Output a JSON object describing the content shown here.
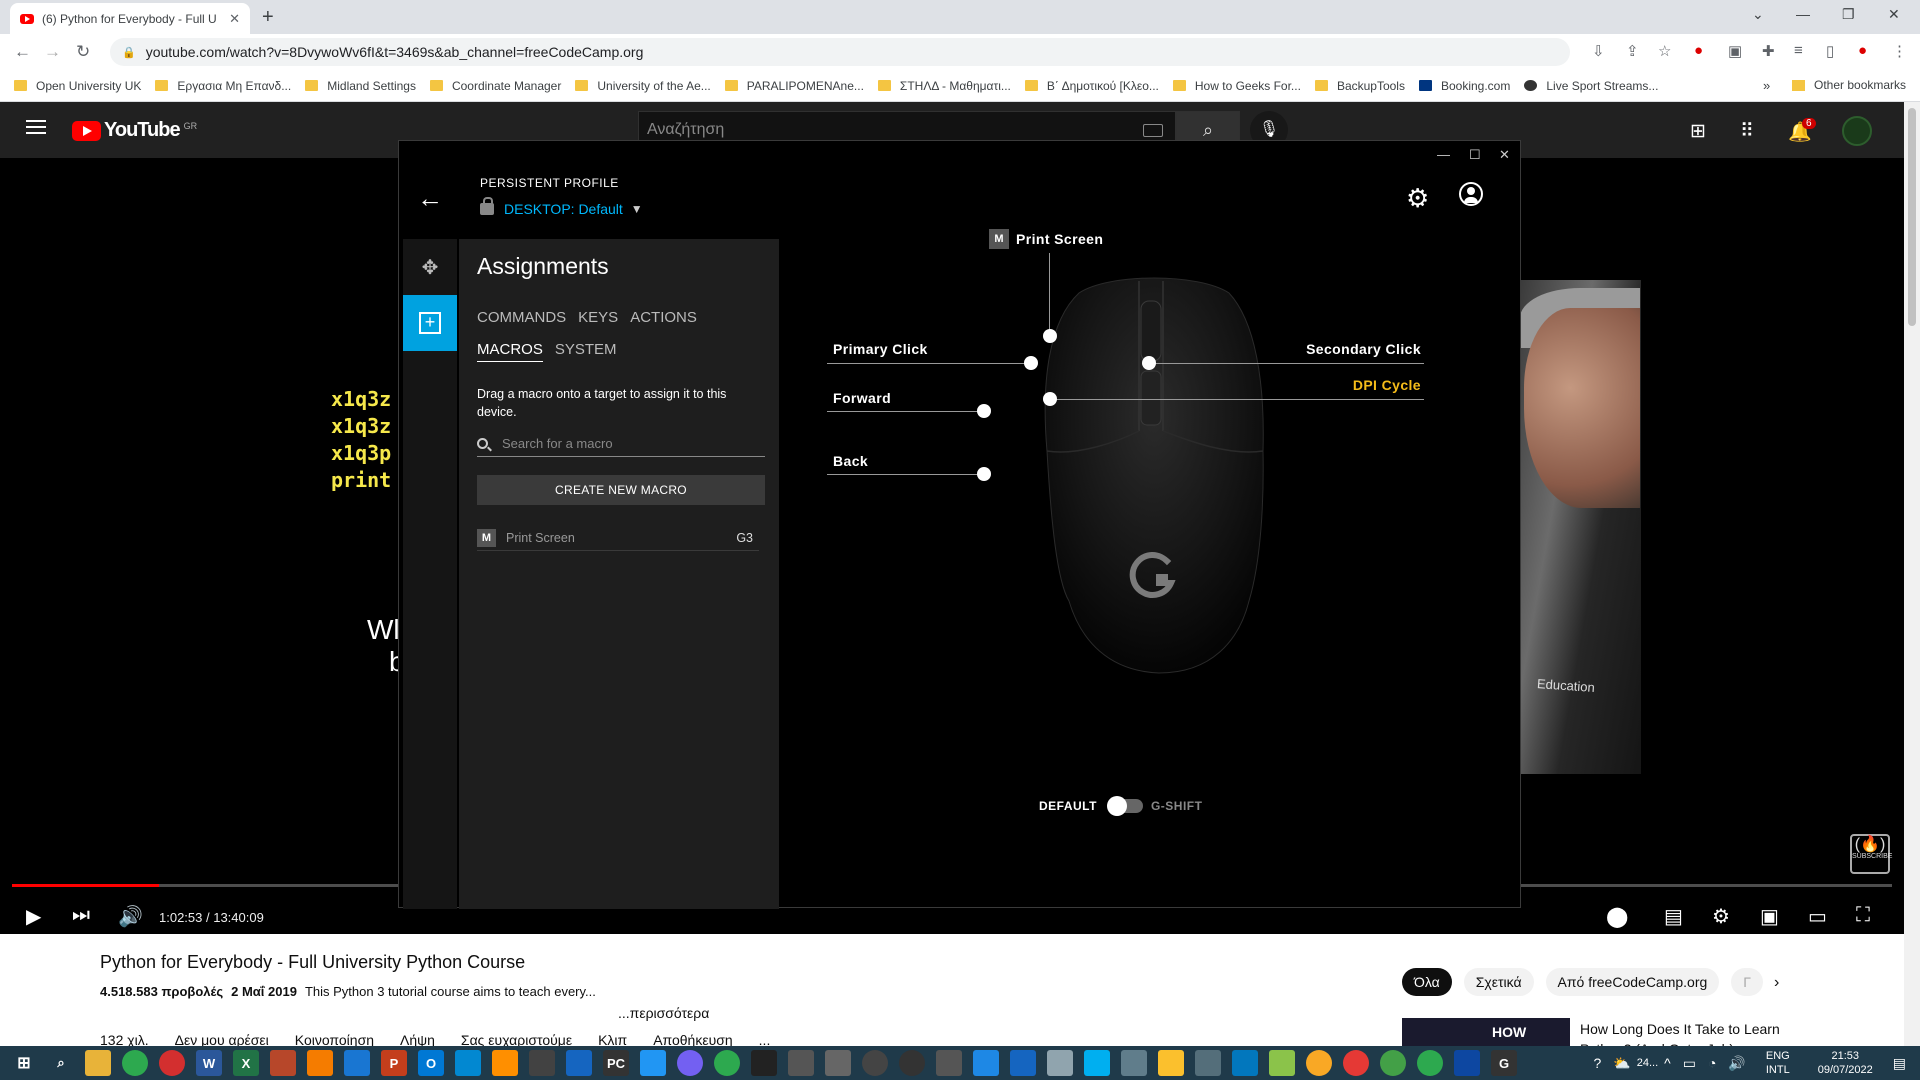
{
  "browser": {
    "tab_title": "(6) Python for Everybody - Full U",
    "url": "youtube.com/watch?v=8DvywoWv6fI&t=3469s&ab_channel=freeCodeCamp.org",
    "bookmarks": [
      "Open University UK",
      "Εργασια Μη Επανδ...",
      "Midland Settings",
      "Coordinate Manager",
      "University of the Ae...",
      "PARALIPOMENAne...",
      "ΣΤΗΛΔ - Μαθηματι...",
      "Β΄ Δημοτικού [Κλεο...",
      "How to Geeks For...",
      "BackupTools",
      "Booking.com",
      "Live Sport Streams..."
    ],
    "bookmarks_more": "»",
    "other_bookmarks": "Other bookmarks"
  },
  "youtube": {
    "logo": "YouTube",
    "country": "GR",
    "search_placeholder": "Αναζήτηση",
    "notification_count": "6",
    "video": {
      "code_lines": [
        "x1q3z",
        "x1q3z",
        "x1q3p",
        "print"
      ],
      "subtitle_lines": [
        "Wl",
        "b"
      ],
      "overlay_text": "Education",
      "subscribe_label": "SUBSCRIBE",
      "progress": 0.0783,
      "time": "1:02:53 / 13:40:09"
    },
    "title": "Python for Everybody - Full University Python Course",
    "views": "4.518.583 προβολές",
    "date": "2 Μαΐ 2019",
    "description": "This Python 3 tutorial course aims to teach every...",
    "more": "...περισσότερα",
    "actions": [
      "132 χιλ.",
      "Δεν μου αρέσει",
      "Κοινοποίηση",
      "Λήψη",
      "Σας ευχαριστούμε",
      "Κλιπ",
      "Αποθήκευση",
      "..."
    ],
    "chips": [
      "Όλα",
      "Σχετικά",
      "Από freeCodeCamp.org",
      "Γ"
    ],
    "rec": {
      "thumb_text": "HOW",
      "title_line1": "How Long Does It Take to Learn",
      "title_line2": "Python? (And Get a Job)"
    }
  },
  "ghub": {
    "profile_label": "PERSISTENT PROFILE",
    "profile_prefix": "DESKTOP:",
    "profile_name": "Default",
    "panel_title": "Assignments",
    "tabs_row1": [
      "COMMANDS",
      "KEYS",
      "ACTIONS"
    ],
    "tabs_row2": [
      "MACROS",
      "SYSTEM"
    ],
    "active_tab": "MACROS",
    "description": "Drag a macro onto a target to assign it to this device.",
    "search_placeholder": "Search for a macro",
    "create_button": "CREATE NEW MACRO",
    "macros": [
      {
        "icon": "M",
        "name": "Print Screen",
        "key": "G3"
      }
    ],
    "assignments": {
      "top": {
        "badge": "M",
        "label": "Print Screen"
      },
      "primary": "Primary Click",
      "secondary": "Secondary Click",
      "forward": "Forward",
      "dpi": "DPI Cycle",
      "back": "Back"
    },
    "toggle": {
      "left": "DEFAULT",
      "right": "G-SHIFT"
    },
    "colors": {
      "accent": "#00a2e0",
      "highlight": "#f6bd1a"
    }
  },
  "taskbar": {
    "weather": "24...",
    "lang": "ENG",
    "layout": "INTL",
    "time": "21:53",
    "date": "09/07/2022"
  }
}
